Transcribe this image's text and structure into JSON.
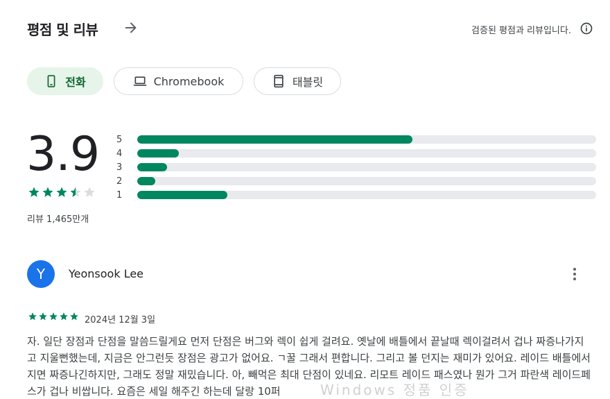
{
  "header": {
    "title": "평점 및 리뷰",
    "verified_text": "검증된 평점과 리뷰입니다."
  },
  "tabs": [
    {
      "label": "전화",
      "icon": "phone-icon",
      "active": true
    },
    {
      "label": "Chromebook",
      "icon": "laptop-icon",
      "active": false
    },
    {
      "label": "태블릿",
      "icon": "tablet-icon",
      "active": false
    }
  ],
  "rating": {
    "score": "3.9",
    "stars": 3.5,
    "review_count": "리뷰 1,465만개",
    "distribution": [
      {
        "label": "5",
        "fraction": 0.6
      },
      {
        "label": "4",
        "fraction": 0.09
      },
      {
        "label": "3",
        "fraction": 0.065
      },
      {
        "label": "2",
        "fraction": 0.04
      },
      {
        "label": "1",
        "fraction": 0.197
      }
    ]
  },
  "review": {
    "avatar_letter": "Y",
    "name": "Yeonsook Lee",
    "stars": 5,
    "date": "2024년 12월 3일",
    "text": "자. 일단 장점과 단점을 말씀드릴게요 먼저 단점은 버그와 렉이 쉽게 걸려요. 옛날에 배틀에서 끝날때 렉이걸려서 겁나 짜증나가지고 지울뻔했는데, 지금은 안그런듯 장점은 광고가 없어요. ㄱ꿀 그래서 편합니다. 그리고 볼 던지는 재미가 있어요. 레이드 배틀에서 지면 짜증나긴하지만, 그래도 정말 재밌습니다. 아, 빼먹은 최대 단점이 있네요. 리모트 레이드 패스였나 뭔가 그거 파란색 레이드페스가 겁나 비쌉니다. 요즘은 세일 해주긴 하는데 달랑 10퍼"
  },
  "watermark": "Windows 정품 인증",
  "colors": {
    "accent_green": "#01875f",
    "chip_active_bg": "#e6f4ea",
    "avatar_blue": "#1a73e8"
  }
}
